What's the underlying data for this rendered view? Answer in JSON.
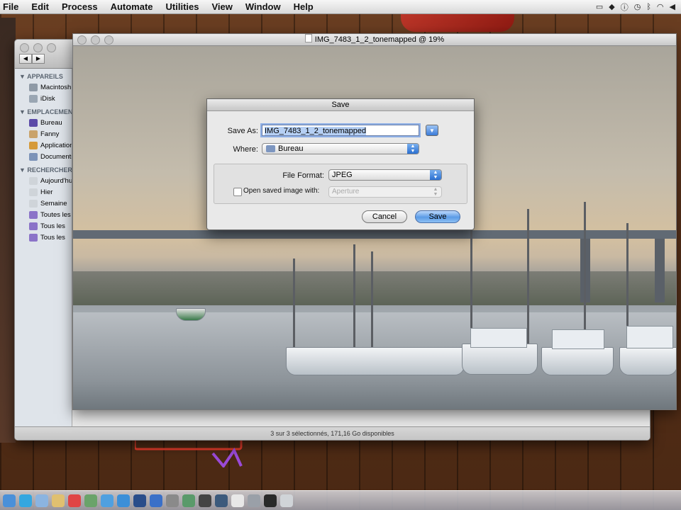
{
  "menubar": {
    "items": [
      "File",
      "Edit",
      "Process",
      "Automate",
      "Utilities",
      "View",
      "Window",
      "Help"
    ],
    "status_icons": [
      "camera-icon",
      "dropbox-icon",
      "info-icon",
      "time-machine-icon",
      "bluetooth-icon",
      "wifi-icon",
      "volume-icon"
    ]
  },
  "finder": {
    "sidebar": {
      "sections": [
        {
          "title": "APPAREILS",
          "items": [
            {
              "label": "Macintosh",
              "icon": "hard-drive-icon",
              "color": "#8f9aa6"
            },
            {
              "label": "iDisk",
              "icon": "idisk-icon",
              "color": "#9aa6b3"
            }
          ]
        },
        {
          "title": "EMPLACEMENTS",
          "items": [
            {
              "label": "Bureau",
              "icon": "desktop-folder-icon",
              "color": "#5b4aa8"
            },
            {
              "label": "Fanny",
              "icon": "home-icon",
              "color": "#c9a36b"
            },
            {
              "label": "Applications",
              "icon": "applications-icon",
              "color": "#d59a3a"
            },
            {
              "label": "Documents",
              "icon": "documents-folder-icon",
              "color": "#7c93b8"
            }
          ]
        },
        {
          "title": "RECHERCHER",
          "items": [
            {
              "label": "Aujourd'hui",
              "icon": "clock-icon",
              "color": "#cfd4d9"
            },
            {
              "label": "Hier",
              "icon": "clock-icon",
              "color": "#cfd4d9"
            },
            {
              "label": "Semaine",
              "icon": "clock-icon",
              "color": "#cfd4d9"
            },
            {
              "label": "Toutes les",
              "icon": "smart-folder-icon",
              "color": "#8b73c8"
            },
            {
              "label": "Tous les",
              "icon": "smart-folder-icon",
              "color": "#8b73c8"
            },
            {
              "label": "Tous les",
              "icon": "smart-folder-icon",
              "color": "#8b73c8"
            }
          ]
        }
      ]
    },
    "status_text": "3 sur 3 sélectionnés, 171,16 Go disponibles"
  },
  "image_window": {
    "title": "IMG_7483_1_2_tonemapped @ 19%"
  },
  "save_dialog": {
    "title": "Save",
    "save_as_label": "Save As:",
    "save_as_value": "IMG_7483_1_2_tonemapped",
    "where_label": "Where:",
    "where_value": "Bureau",
    "file_format_label": "File Format:",
    "file_format_value": "JPEG",
    "open_saved_label": "Open saved image with:",
    "open_saved_checked": false,
    "open_with_value": "Aperture",
    "cancel_label": "Cancel",
    "save_label": "Save"
  },
  "dock": {
    "items": [
      {
        "name": "finder-dock-icon",
        "color": "#4a90d9"
      },
      {
        "name": "skype-dock-icon",
        "color": "#35a7e0"
      },
      {
        "name": "mail-dock-icon",
        "color": "#8bb4e0"
      },
      {
        "name": "preview-dock-icon",
        "color": "#e0c070"
      },
      {
        "name": "calendar-dock-icon",
        "color": "#e04545"
      },
      {
        "name": "contacts-dock-icon",
        "color": "#6aa36a"
      },
      {
        "name": "iphoto-dock-icon",
        "color": "#4fa0e0"
      },
      {
        "name": "safari-dock-icon",
        "color": "#3b8fd8"
      },
      {
        "name": "photoshop-dock-icon",
        "color": "#2a4d8a"
      },
      {
        "name": "itunes-dock-icon",
        "color": "#3a70c8"
      },
      {
        "name": "system-preferences-dock-icon",
        "color": "#8a8a8a"
      },
      {
        "name": "photomatix-dock-icon",
        "color": "#5a9a6a"
      },
      {
        "name": "aperture-dock-icon",
        "color": "#444444"
      },
      {
        "name": "lightroom-dock-icon",
        "color": "#3c5a7c"
      },
      {
        "name": "textedit-dock-icon",
        "color": "#e8e8e8"
      },
      {
        "name": "utilities-dock-icon",
        "color": "#9aa0a8"
      },
      {
        "name": "dashboard-dock-icon",
        "color": "#2a2a2a"
      },
      {
        "name": "trash-dock-icon",
        "color": "#d0d4d8"
      }
    ]
  },
  "colors": {
    "accent_blue": "#5b9be6",
    "selection": "#b6d0f4",
    "desktop_wood": "#5a321a"
  }
}
